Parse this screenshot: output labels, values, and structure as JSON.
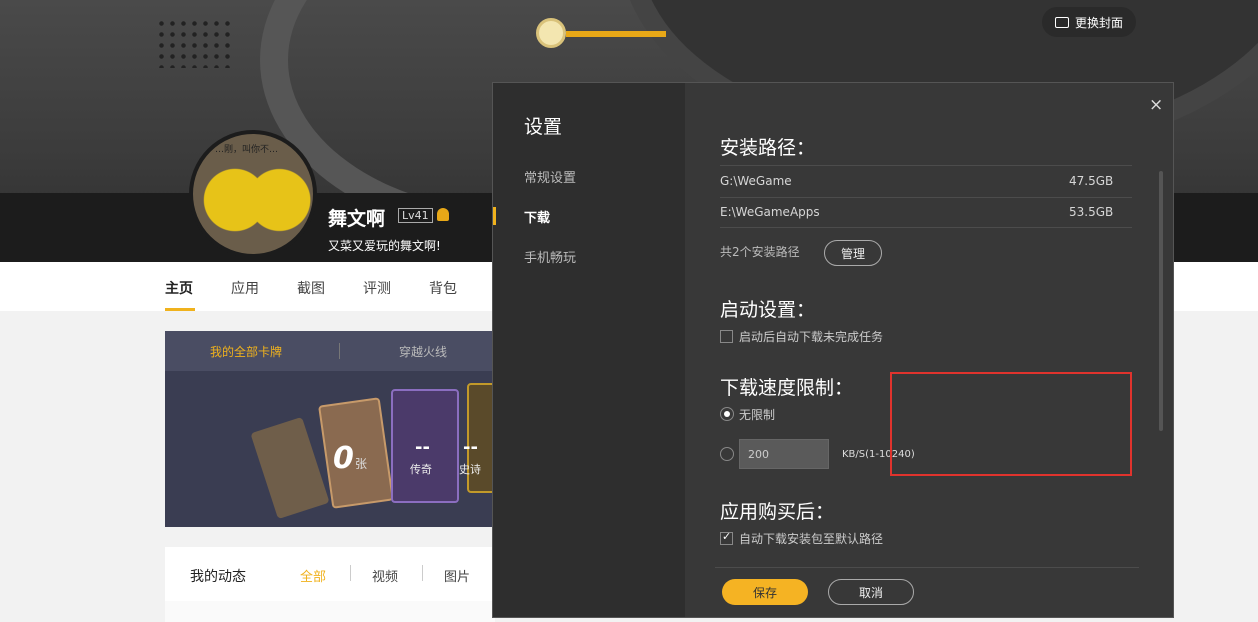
{
  "profile": {
    "change_cover": "更换封面",
    "username": "舞文啊",
    "level": "Lv41",
    "motto": "又菜又爱玩的舞文啊!",
    "avatar_caption": "…刚，叫你不…"
  },
  "nav": {
    "tabs": [
      "主页",
      "应用",
      "截图",
      "评测",
      "背包"
    ]
  },
  "cards": {
    "tab_all": "我的全部卡牌",
    "tab_game": "穿越火线",
    "count": "0",
    "count_unit": "张",
    "legend_label": "传奇",
    "epic_label": "史诗",
    "dash": "--"
  },
  "feed": {
    "title": "我的动态",
    "filters": [
      "全部",
      "视频",
      "图片"
    ]
  },
  "dialog": {
    "title": "设置",
    "menu": [
      "常规设置",
      "下载",
      "手机畅玩"
    ],
    "close": "×",
    "install": {
      "heading": "安装路径：",
      "paths": [
        {
          "path": "G:\\WeGame",
          "size": "47.5GB"
        },
        {
          "path": "E:\\WeGameApps",
          "size": "53.5GB"
        }
      ],
      "count_text": "共2个安装路径",
      "manage": "管理"
    },
    "startup": {
      "heading": "启动设置：",
      "option": "启动后自动下载未完成任务",
      "checked": false
    },
    "speed": {
      "heading": "下载速度限制：",
      "unlimited": "无限制",
      "limit_value": "200",
      "unit": "KB/S(1-10240)",
      "selected": "unlimited"
    },
    "purchase": {
      "heading": "应用购买后：",
      "option": "自动下载安装包至默认路径",
      "checked": true
    },
    "save": "保存",
    "cancel": "取消"
  },
  "colors": {
    "accent": "#f5b323",
    "highlight_box": "#e0332d",
    "dialog_bg": "#383838"
  }
}
